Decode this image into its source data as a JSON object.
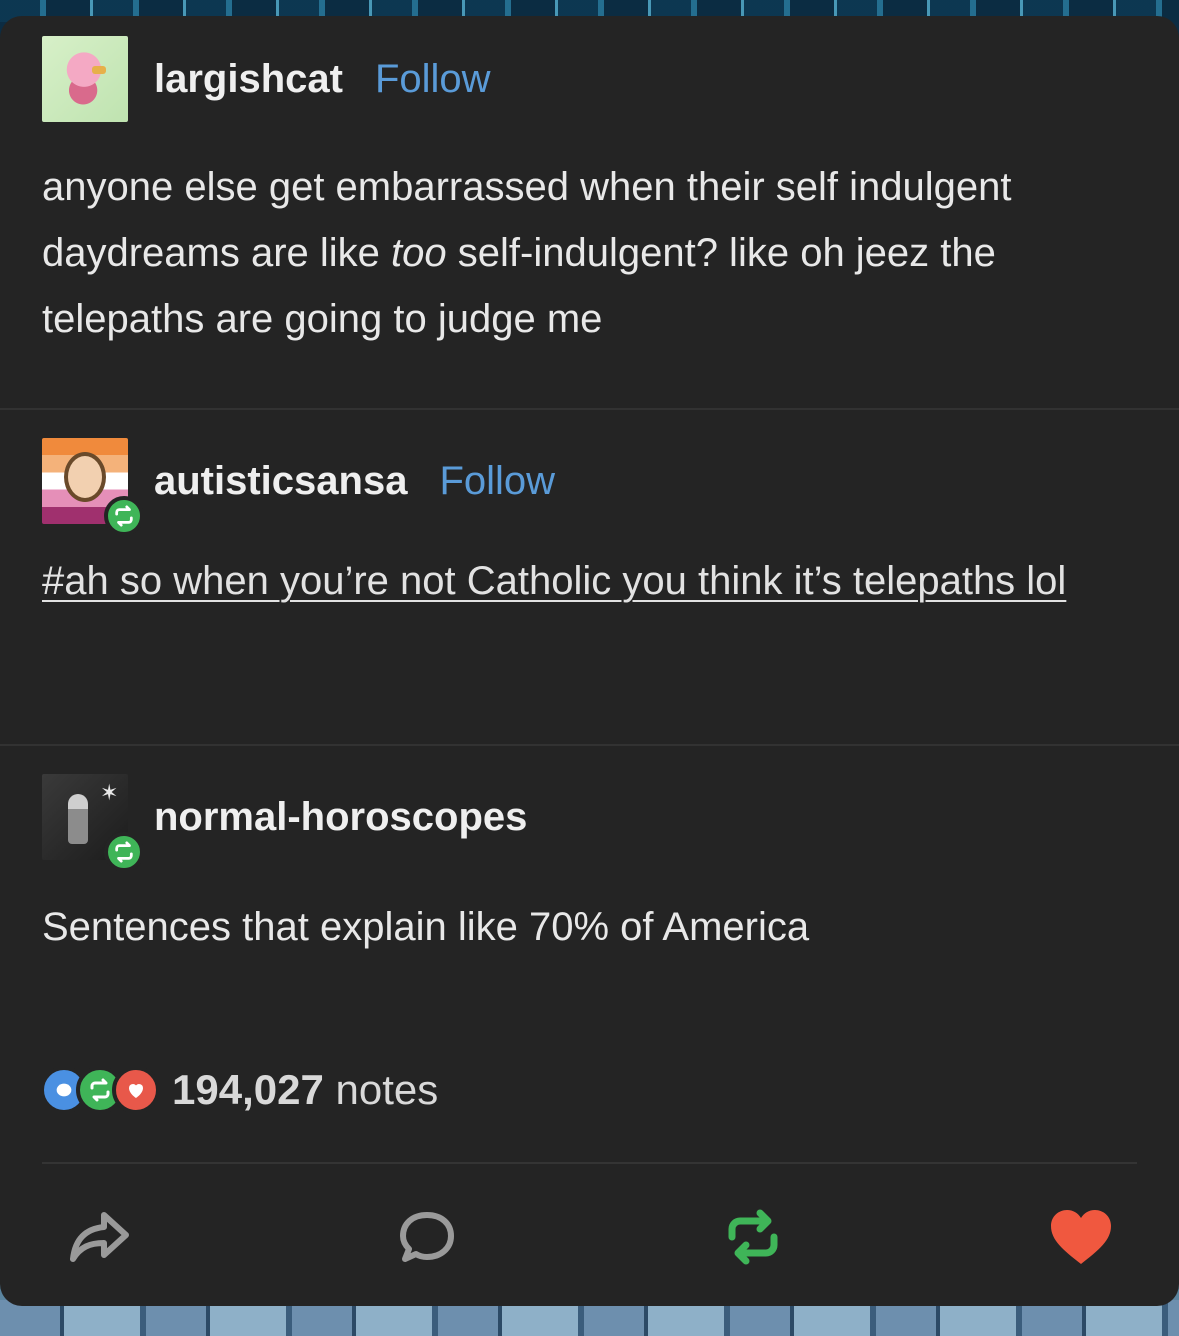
{
  "posts": [
    {
      "username": "largishcat",
      "follow_label": "Follow",
      "avatar_icon": "pink-bird-avatar",
      "text_before": "anyone else get embarrassed when their self indulgent daydreams are like ",
      "text_emphasis": "too",
      "text_after": " self-indulgent? like oh jeez the telepaths are going to judge me"
    },
    {
      "username": "autisticsansa",
      "follow_label": "Follow",
      "avatar_icon": "pride-flag-avatar",
      "reblogged": true,
      "tags": "#ah so when you’re not Catholic you think it’s telepaths lol"
    },
    {
      "username": "normal-horoscopes",
      "avatar_icon": "dark-figure-avatar",
      "reblogged": true,
      "text": "Sentences that explain like 70% of America"
    }
  ],
  "notes": {
    "count": "194,027",
    "label": "notes"
  },
  "actions": {
    "share_icon": "share-icon",
    "reply_icon": "reply-icon",
    "reblog_icon": "reblog-icon",
    "like_icon": "heart-icon"
  },
  "colors": {
    "card_bg": "#242424",
    "follow": "#5a9bd8",
    "reblog_green": "#3fb558",
    "like_red": "#e8584a",
    "reply_blue": "#4a90e2"
  }
}
